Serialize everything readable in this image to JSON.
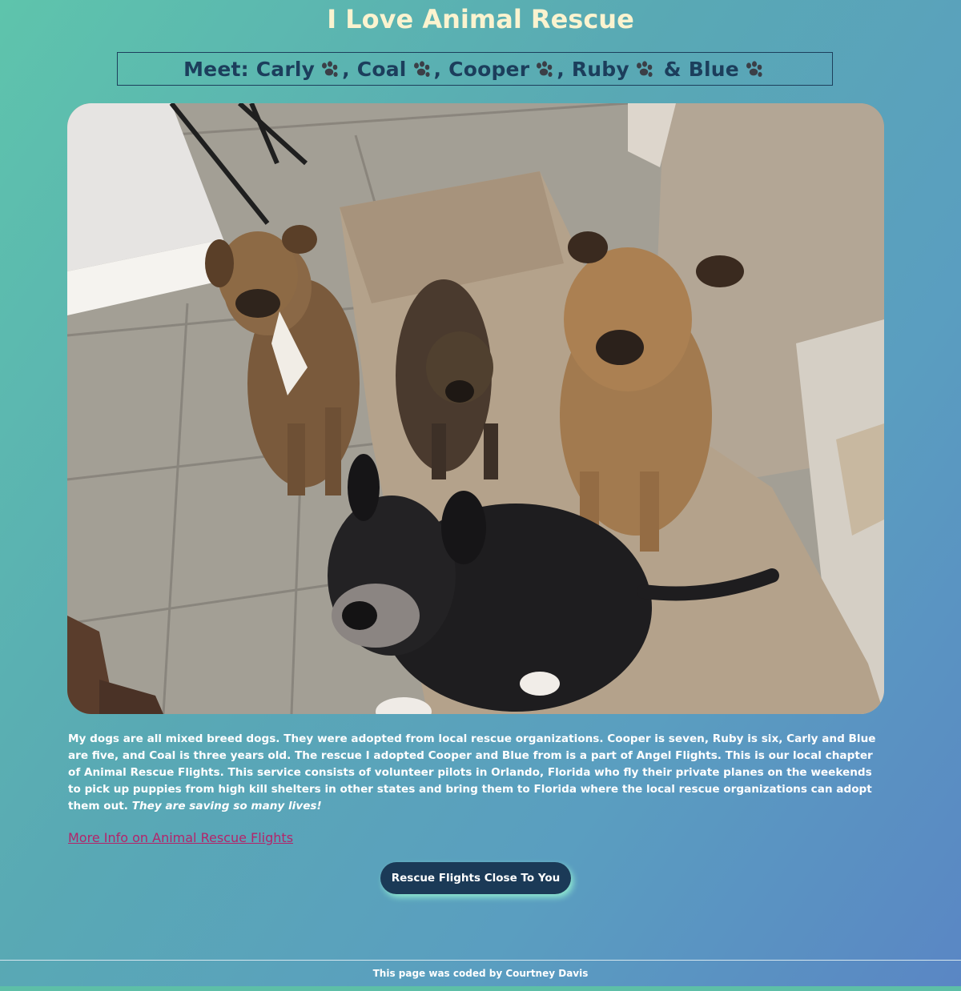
{
  "header": {
    "title": "I Love Animal Rescue",
    "meet": {
      "prefix": "Meet: ",
      "names": [
        "Carly",
        "Coal",
        "Cooper",
        "Ruby",
        "Blue"
      ],
      "separators": [
        ", ",
        ", ",
        ", ",
        " & ",
        ""
      ],
      "icon": "paw-print-icon"
    }
  },
  "photo": {
    "subject": "Five rescue dogs looking up at the camera"
  },
  "main": {
    "description_text": "My dogs are all mixed breed dogs. They were adopted from local rescue organizations. Cooper is seven, Ruby is six, Carly and Blue are five, and Coal is three years old. The rescue I adopted Cooper and Blue from is a part of Angel Flights. This is our local chapter of Animal Rescue Flights. This service consists of volunteer pilots in Orlando, Florida who fly their private planes on the weekends to pick up puppies from high kill shelters in other states and bring them to Florida where the local rescue organizations can adopt them out. ",
    "description_emphasis": "They are saving so many lives!",
    "more_info_link": "More Info on Animal Rescue Flights",
    "button_label": "Rescue Flights Close To You"
  },
  "footer": {
    "credit": "This page was coded by Courtney Davis"
  },
  "colors": {
    "title": "#fbf3cf",
    "meet_text": "#1c3e5c",
    "link": "#b3246a",
    "button_bg": "#1b3a57",
    "button_glow": "#96f5d2"
  }
}
